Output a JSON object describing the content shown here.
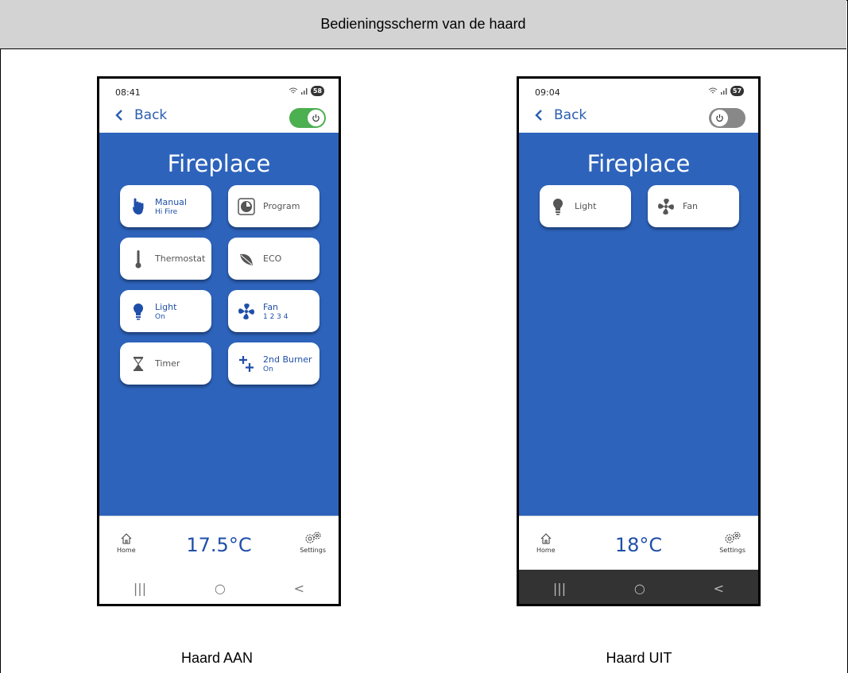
{
  "doc": {
    "title": "Bedieningsscherm van de haard",
    "caption_on": "Haard AAN",
    "caption_off": "Haard UIT"
  },
  "colors": {
    "brand_blue": "#2d63bb",
    "toggle_on": "#4caf50",
    "toggle_off": "#888888"
  },
  "phone_on": {
    "time": "08:41",
    "battery": "58",
    "back_label": "Back",
    "power_toggle": "on",
    "title": "Fireplace",
    "tiles": [
      {
        "icon": "hand-icon",
        "label": "Manual",
        "sub": "Hi Fire",
        "active": true
      },
      {
        "icon": "clock-icon",
        "label": "Program",
        "sub": "",
        "active": false
      },
      {
        "icon": "thermometer-icon",
        "label": "Thermostat",
        "sub": "",
        "active": false
      },
      {
        "icon": "leaf-icon",
        "label": "ECO",
        "sub": "",
        "active": false
      },
      {
        "icon": "bulb-icon",
        "label": "Light",
        "sub": "On",
        "active": true
      },
      {
        "icon": "fan-icon",
        "label": "Fan",
        "sub": "1 2 3 4",
        "active": true
      },
      {
        "icon": "hourglass-icon",
        "label": "Timer",
        "sub": "",
        "active": false
      },
      {
        "icon": "burner-icon",
        "label": "2nd Burner",
        "sub": "On",
        "active": true
      }
    ],
    "temperature": "17.5°C",
    "nav_home": "Home",
    "nav_settings": "Settings"
  },
  "phone_off": {
    "time": "09:04",
    "battery": "57",
    "back_label": "Back",
    "power_toggle": "off",
    "title": "Fireplace",
    "tiles": [
      {
        "icon": "bulb-icon",
        "label": "Light",
        "sub": ""
      },
      {
        "icon": "fan-icon",
        "label": "Fan",
        "sub": ""
      }
    ],
    "temperature": "18°C",
    "nav_home": "Home",
    "nav_settings": "Settings"
  }
}
